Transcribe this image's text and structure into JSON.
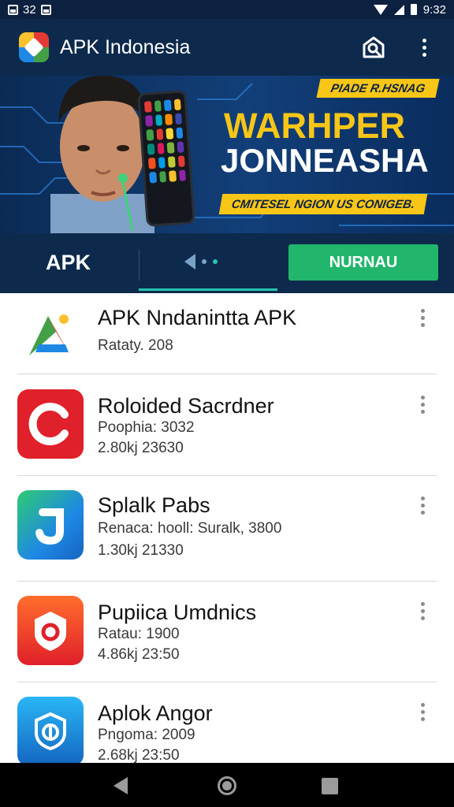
{
  "status_bar": {
    "left_text": "32",
    "time": "9:32"
  },
  "app_bar": {
    "title": "APK Indonesia"
  },
  "banner": {
    "tag": "PIADE R.HSNAG",
    "headline_1": "WARHPER",
    "headline_2": "JONNEASHA",
    "sub": "CMITESEL NGION US CONIGEB."
  },
  "tabs": {
    "apk_label": "APK",
    "green_button_label": "NURNAU"
  },
  "apps": [
    {
      "name": "APK Nndanintta APK",
      "line1": "Rataty. 208",
      "line2": "",
      "icon": "colorful-a-icon"
    },
    {
      "name": "Roloided Sacrdner",
      "line1": "Poophia: 3032",
      "line2": "2.80kj 23630",
      "icon": "red-c-icon"
    },
    {
      "name": "Splalk Pabs",
      "line1": "Renaca: hooll: Suralk, 3800",
      "line2": "1.30kj 21330",
      "icon": "blue-j-icon"
    },
    {
      "name": "Pupiica Umdnics",
      "line1": "Ratau: 1900",
      "line2": "4.86kj 23:50",
      "icon": "red-shield-icon"
    },
    {
      "name": "Aplok Angor",
      "line1": "Pngoma: 2009",
      "line2": "2.68kj 23:50",
      "icon": "blue-shield-icon"
    }
  ],
  "colors": {
    "app_bar": "#0d2a4c",
    "accent_teal": "#27c4b0",
    "accent_green": "#21b66b",
    "banner_yellow": "#f8c617"
  }
}
